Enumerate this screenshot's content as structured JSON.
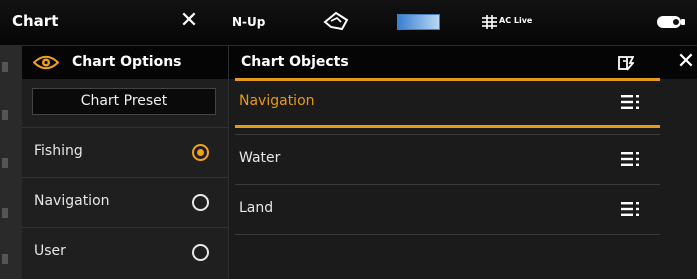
{
  "topbar": {
    "title": "Chart",
    "orientation": "N-Up",
    "autochart_live": "AC Live",
    "icons": [
      "close-icon",
      "boat-icon",
      "battery-icon"
    ]
  },
  "options_panel": {
    "title": "Chart Options",
    "preset_label": "Chart Preset",
    "presets": [
      {
        "label": "Fishing",
        "selected": true
      },
      {
        "label": "Navigation",
        "selected": false
      },
      {
        "label": "User",
        "selected": false
      }
    ]
  },
  "objects_panel": {
    "title": "Chart Objects",
    "items": [
      {
        "label": "Navigation",
        "active": true
      },
      {
        "label": "Water",
        "active": false
      },
      {
        "label": "Land",
        "active": false
      }
    ]
  },
  "colors": {
    "accent": "#e49a1a",
    "header_bg": "#050505",
    "panel_bg": "#1f1f1f"
  }
}
